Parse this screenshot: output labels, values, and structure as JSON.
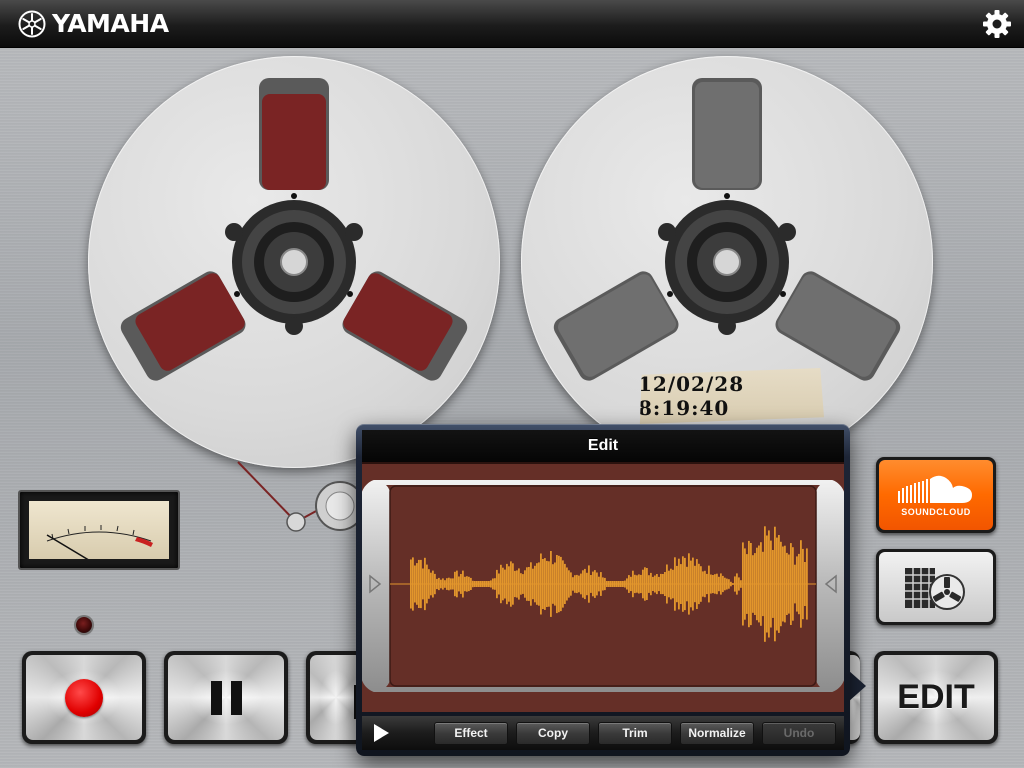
{
  "header": {
    "brand": "YAMAHA",
    "logo_icon": "yamaha-tuning-fork-logo",
    "settings_icon": "gear-icon"
  },
  "reels": {
    "left_spoke_color": "#7a2424",
    "right_spoke_color": "#6f6f6f",
    "timestamp": "12/02/28 8:19:40"
  },
  "transport": {
    "record_icon": "record-dot-icon",
    "pause_icon": "pause-icon",
    "stop_icon": "stop-icon",
    "edit_label": "EDIT"
  },
  "side_buttons": {
    "soundcloud_label": "SOUNDCLOUD",
    "library_icon": "tape-library-icon"
  },
  "edit_popover": {
    "title": "Edit",
    "waveform_color": "#e2962c",
    "background_color": "#652f27",
    "toolbar": {
      "play_icon": "play-icon",
      "buttons": [
        {
          "label": "Effect",
          "enabled": true
        },
        {
          "label": "Copy",
          "enabled": true
        },
        {
          "label": "Trim",
          "enabled": true
        },
        {
          "label": "Normalize",
          "enabled": true
        },
        {
          "label": "Undo",
          "enabled": false
        }
      ]
    }
  }
}
